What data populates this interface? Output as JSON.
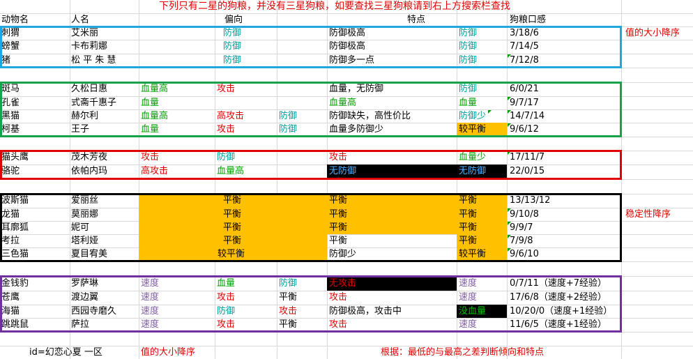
{
  "title_note": "下列只有二星的狗粮，并没有三星狗粮，如要查找三星狗粮请到右上方搜索栏查找",
  "headers": {
    "animal": "动物名",
    "name": "人名",
    "tendency": "偏向",
    "feature": "特点",
    "taste": "狗粮口感"
  },
  "side_notes": {
    "value_desc": "值的大小降序",
    "stability_desc": "稳定性降序"
  },
  "footer": {
    "id": "id=幻恋心夏 一区",
    "value_desc": "值的大小降序",
    "basis": "根据：最低的与最高之差判断倾向和特点"
  },
  "group1": [
    {
      "animal": "刺猬",
      "name": "艾米丽",
      "t1": "",
      "t2": "防御",
      "t3": "",
      "f1": "防御极高",
      "f2": "防御",
      "taste": "3/18/6"
    },
    {
      "animal": "螃蟹",
      "name": "卡布莉娜",
      "t1": "",
      "t2": "防御",
      "t3": "",
      "f1": "防御极高",
      "f2": "防御",
      "taste": "7/14/5"
    },
    {
      "animal": "猪",
      "name": "松 平 朱 慧",
      "t1": "",
      "t2": "防御",
      "t3": "",
      "f1": "防御多一点",
      "f2": "防御",
      "taste": "7/12/8"
    }
  ],
  "group2": [
    {
      "animal": "斑马",
      "name": "久松日惠",
      "t1": "血量高",
      "t2": "攻击",
      "t3": "",
      "f1": "血量，无防御",
      "f2": "防御",
      "taste": "6/0/21"
    },
    {
      "animal": "孔雀",
      "name": "式斋千惠子",
      "t1": "血量",
      "t2": "",
      "t3": "",
      "f1": "血量高",
      "f2": "血量",
      "taste": "9/7/17"
    },
    {
      "animal": "黑猫",
      "name": "赫尔利",
      "t1": "血量高",
      "t2": "高攻击",
      "t3": "防御",
      "f1": "防御缺失，高性价比",
      "f2": "防御少",
      "taste": "14/7/14"
    },
    {
      "animal": "柯基",
      "name": "王子",
      "t1": "血量",
      "t2": "攻击",
      "t3": "防御",
      "f1": "血量多防御少",
      "f2": "较平衡",
      "taste": "9/6/12"
    }
  ],
  "group3": [
    {
      "animal": "猫头鹰",
      "name": "茂木芳夜",
      "t1": "攻击",
      "t2": "防御",
      "t3": "",
      "f1": "攻击",
      "f2": "血量少",
      "taste": "17/11/7"
    },
    {
      "animal": "骆驼",
      "name": "依帕内玛",
      "t1": "高攻击",
      "t2": "血量高",
      "t3": "",
      "f1": "无防御",
      "f2": "无防御",
      "taste": "22/0/15"
    }
  ],
  "group4": [
    {
      "animal": "波斯猫",
      "name": "爱丽丝",
      "t2": "平衡",
      "f1": "平衡",
      "f2": "平衡",
      "taste": "13/13/12"
    },
    {
      "animal": "龙猫",
      "name": "莫丽娜",
      "t2": "平衡",
      "f1": "平衡",
      "f2": "平衡",
      "taste": "9/10/8"
    },
    {
      "animal": "耳廓狐",
      "name": "妮可",
      "t2": "平衡",
      "f1": "平衡",
      "f2": "平衡",
      "taste": "9/9/7"
    },
    {
      "animal": "考拉",
      "name": "塔利娅",
      "t2": "平衡",
      "f1": "平衡",
      "f2": "平衡",
      "taste": "7/9/8"
    },
    {
      "animal": "三色猫",
      "name": "夏目宥美",
      "t2": "较平衡",
      "f1": "防御少",
      "f2": "较平衡",
      "taste": "9/6/10"
    }
  ],
  "group5": [
    {
      "animal": "金钱豹",
      "name": "罗萨琳",
      "t1": "速度",
      "t2": "血量",
      "t3": "防御",
      "f1": "无攻击",
      "f2": "速度",
      "taste": "0/7/11（速度+7经验）"
    },
    {
      "animal": "苍鹰",
      "name": "渡边翼",
      "t1": "速度",
      "t2": "攻击",
      "t3": "平衡",
      "f1": "攻击",
      "f2": "速度",
      "taste": "17/6/8（速度+2经验）"
    },
    {
      "animal": "海猫",
      "name": "西园寺磨久",
      "t1": "速度",
      "t2": "防御",
      "t3": "攻击",
      "f1": "防御极高，攻击中",
      "f2": "没血量",
      "taste": "10/20/0（速度+1经验）"
    },
    {
      "animal": "跳跳鼠",
      "name": "萨拉",
      "t1": "速度",
      "t2": "攻击",
      "t3": "平衡",
      "f1": "攻击",
      "f2": "速度",
      "taste": "11/6/5（速度+1经验）"
    }
  ],
  "colors": {
    "blue": "#1fa8dd",
    "green": "#16a34a",
    "red": "#e00000",
    "black": "#000000",
    "purple": "#7030a0",
    "orange": "#ffc000"
  }
}
